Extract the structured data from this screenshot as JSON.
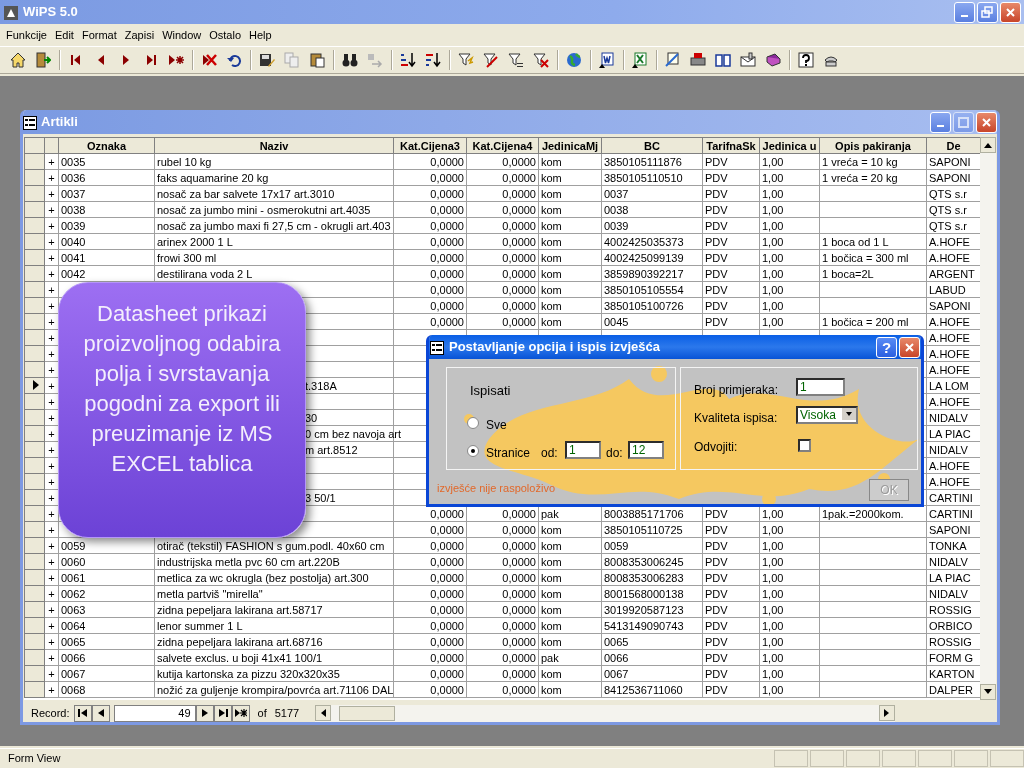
{
  "app": {
    "title": "WiPS 5.0"
  },
  "menu": [
    "Funkcije",
    "Edit",
    "Format",
    "Zapisi",
    "Window",
    "Ostalo",
    "Help"
  ],
  "window": {
    "title": "Artikli",
    "controls": [
      {
        "kind": "minimize",
        "disabled": false
      },
      {
        "kind": "maximize",
        "disabled": true
      },
      {
        "kind": "close",
        "disabled": false
      }
    ],
    "columns": [
      "Oznaka",
      "Naziv",
      "Kat.Cijena3",
      "Kat.Cijena4",
      "JedinicaMj",
      "BC",
      "TarifnaSk",
      "Jedinica u",
      "Opis pakiranja",
      "De"
    ],
    "rows": [
      {
        "current": false,
        "expander": "+",
        "oznaka": "0035",
        "naziv": "rubel 10 kg",
        "kat_cijena3": "0,0000",
        "kat_cijena4": "0,0000",
        "jedinica_mj": "kom",
        "bc": "3850105111876",
        "tarifna_sk": "PDV",
        "jedinica_u": "1,00",
        "opis_pakiranja": "1 vreća = 10 kg",
        "de": "SAPONI"
      },
      {
        "current": false,
        "expander": "+",
        "oznaka": "0036",
        "naziv": "faks aquamarine  20 kg",
        "kat_cijena3": "0,0000",
        "kat_cijena4": "0,0000",
        "jedinica_mj": "kom",
        "bc": "3850105110510",
        "tarifna_sk": "PDV",
        "jedinica_u": "1,00",
        "opis_pakiranja": "1 vreća = 20 kg",
        "de": "SAPONI"
      },
      {
        "current": false,
        "expander": "+",
        "oznaka": "0037",
        "naziv": "nosač za bar salvete 17x17 art.3010",
        "kat_cijena3": "0,0000",
        "kat_cijena4": "0,0000",
        "jedinica_mj": "kom",
        "bc": "0037",
        "tarifna_sk": "PDV",
        "jedinica_u": "1,00",
        "de": "QTS s.r"
      },
      {
        "current": false,
        "expander": "+",
        "oznaka": "0038",
        "naziv": "nosač za jumbo mini - osmerokutni art.4035",
        "kat_cijena3": "0,0000",
        "kat_cijena4": "0,0000",
        "jedinica_mj": "kom",
        "bc": "0038",
        "tarifna_sk": "PDV",
        "jedinica_u": "1,00",
        "de": "QTS s.r"
      },
      {
        "current": false,
        "expander": "+",
        "oznaka": "0039",
        "naziv": "nosač za jumbo maxi fi 27,5 cm - okrugli art.403",
        "kat_cijena3": "0,0000",
        "kat_cijena4": "0,0000",
        "jedinica_mj": "kom",
        "bc": "0039",
        "tarifna_sk": "PDV",
        "jedinica_u": "1,00",
        "de": "QTS s.r"
      },
      {
        "current": false,
        "expander": "+",
        "oznaka": "0040",
        "naziv": "arinex 2000 1 L",
        "kat_cijena3": "0,0000",
        "kat_cijena4": "0,0000",
        "jedinica_mj": "kom",
        "bc": "4002425035373",
        "tarifna_sk": "PDV",
        "jedinica_u": "1,00",
        "opis_pakiranja": "1 boca od 1 L",
        "de": "A.HOFE"
      },
      {
        "current": false,
        "expander": "+",
        "oznaka": "0041",
        "naziv": "frowi 300 ml",
        "kat_cijena3": "0,0000",
        "kat_cijena4": "0,0000",
        "jedinica_mj": "kom",
        "bc": "4002425099139",
        "tarifna_sk": "PDV",
        "jedinica_u": "1,00",
        "opis_pakiranja": "1 bočica = 300 ml",
        "de": "A.HOFE"
      },
      {
        "current": false,
        "expander": "+",
        "oznaka": "0042",
        "naziv": "destilirana voda 2 L",
        "kat_cijena3": "0,0000",
        "kat_cijena4": "0,0000",
        "jedinica_mj": "kom",
        "bc": "3859890392217",
        "tarifna_sk": "PDV",
        "jedinica_u": "1,00",
        "opis_pakiranja": "1 boca=2L",
        "de": "ARGENT"
      },
      {
        "current": false,
        "expander": "+",
        "kat_cijena3": "0,0000",
        "kat_cijena4": "0,0000",
        "jedinica_mj": "kom",
        "bc": "3850105105554",
        "tarifna_sk": "PDV",
        "jedinica_u": "1,00",
        "de": "LABUD"
      },
      {
        "current": false,
        "expander": "+",
        "kat_cijena3": "0,0000",
        "kat_cijena4": "0,0000",
        "jedinica_mj": "kom",
        "bc": "3850105100726",
        "tarifna_sk": "PDV",
        "jedinica_u": "1,00",
        "de": "SAPONI"
      },
      {
        "current": false,
        "expander": "+",
        "kat_cijena3": "0,0000",
        "kat_cijena4": "0,0000",
        "jedinica_mj": "kom",
        "bc": "0045",
        "tarifna_sk": "PDV",
        "jedinica_u": "1,00",
        "opis_pakiranja": "1 bočica = 200 ml",
        "de": "A.HOFE"
      },
      {
        "current": false,
        "expander": "+",
        "de": "A.HOFE"
      },
      {
        "current": false,
        "expander": "+",
        "de": "A.HOFE"
      },
      {
        "current": false,
        "expander": "+",
        "de": "A.HOFE"
      },
      {
        "current": true,
        "expander": "+",
        "naziv_tail": "t.318A",
        "de": "LA LOM"
      },
      {
        "current": false,
        "expander": "+",
        "de": "A.HOFE"
      },
      {
        "current": false,
        "expander": "+",
        "naziv_tail": "30",
        "de": "NIDALV"
      },
      {
        "current": false,
        "expander": "+",
        "naziv_tail": "0 cm bez navoja art",
        "de": "LA PIAC"
      },
      {
        "current": false,
        "expander": "+",
        "naziv_tail": "m art.8512",
        "de": "NIDALV"
      },
      {
        "current": false,
        "expander": "+",
        "de": "A.HOFE"
      },
      {
        "current": false,
        "expander": "+",
        "de": "A.HOFE"
      },
      {
        "current": false,
        "expander": "+",
        "naziv_tail": "3 50/1",
        "de": "CARTINI"
      },
      {
        "current": false,
        "expander": "+",
        "kat_cijena3": "0,0000",
        "kat_cijena4": "0,0000",
        "jedinica_mj": "pak",
        "bc": "8003885171706",
        "tarifna_sk": "PDV",
        "jedinica_u": "1,00",
        "opis_pakiranja": "1pak.=2000kom.",
        "de": "CARTINI"
      },
      {
        "current": false,
        "expander": "+",
        "kat_cijena3": "0,0000",
        "kat_cijena4": "0,0000",
        "jedinica_mj": "kom",
        "bc": "3850105110725",
        "tarifna_sk": "PDV",
        "jedinica_u": "1,00",
        "de": "SAPONI"
      },
      {
        "current": false,
        "expander": "+",
        "oznaka": "0059",
        "naziv": "otirač (tekstil) FASHION s gum.podl. 40x60 cm",
        "kat_cijena3": "0,0000",
        "kat_cijena4": "0,0000",
        "jedinica_mj": "kom",
        "bc": "0059",
        "tarifna_sk": "PDV",
        "jedinica_u": "1,00",
        "de": "TONKA"
      },
      {
        "current": false,
        "expander": "+",
        "oznaka": "0060",
        "naziv": "industrijska metla pvc 60 cm art.220B",
        "kat_cijena3": "0,0000",
        "kat_cijena4": "0,0000",
        "jedinica_mj": "kom",
        "bc": "8008353006245",
        "tarifna_sk": "PDV",
        "jedinica_u": "1,00",
        "de": "NIDALV"
      },
      {
        "current": false,
        "expander": "+",
        "oznaka": "0061",
        "naziv": "metlica za wc okrugla (bez postolja) art.300",
        "kat_cijena3": "0,0000",
        "kat_cijena4": "0,0000",
        "jedinica_mj": "kom",
        "bc": "8008353006283",
        "tarifna_sk": "PDV",
        "jedinica_u": "1,00",
        "de": "LA PIAC"
      },
      {
        "current": false,
        "expander": "+",
        "oznaka": "0062",
        "naziv": "metla partviš \"mirella\"",
        "kat_cijena3": "0,0000",
        "kat_cijena4": "0,0000",
        "jedinica_mj": "kom",
        "bc": "8001568000138",
        "tarifna_sk": "PDV",
        "jedinica_u": "1,00",
        "de": "NIDALV"
      },
      {
        "current": false,
        "expander": "+",
        "oznaka": "0063",
        "naziv": "zidna pepeljara lakirana art.58717",
        "kat_cijena3": "0,0000",
        "kat_cijena4": "0,0000",
        "jedinica_mj": "kom",
        "bc": "3019920587123",
        "tarifna_sk": "PDV",
        "jedinica_u": "1,00",
        "de": "ROSSIG"
      },
      {
        "current": false,
        "expander": "+",
        "oznaka": "0064",
        "naziv": "lenor summer 1 L",
        "kat_cijena3": "0,0000",
        "kat_cijena4": "0,0000",
        "jedinica_mj": "kom",
        "bc": "5413149090743",
        "tarifna_sk": "PDV",
        "jedinica_u": "1,00",
        "de": "ORBICO"
      },
      {
        "current": false,
        "expander": "+",
        "oznaka": "0065",
        "naziv": "zidna pepeljara lakirana art.68716",
        "kat_cijena3": "0,0000",
        "kat_cijena4": "0,0000",
        "jedinica_mj": "kom",
        "bc": "0065",
        "tarifna_sk": "PDV",
        "jedinica_u": "1,00",
        "de": "ROSSIG"
      },
      {
        "current": false,
        "expander": "+",
        "oznaka": "0066",
        "naziv": "salvete exclus. u boji 41x41 100/1",
        "kat_cijena3": "0,0000",
        "kat_cijena4": "0,0000",
        "jedinica_mj": "pak",
        "bc": "0066",
        "tarifna_sk": "PDV",
        "jedinica_u": "1,00",
        "de": "FORM G"
      },
      {
        "current": false,
        "expander": "+",
        "oznaka": "0067",
        "naziv": "kutija kartonska  za pizzu 320x320x35",
        "kat_cijena3": "0,0000",
        "kat_cijena4": "0,0000",
        "jedinica_mj": "kom",
        "bc": "0067",
        "tarifna_sk": "PDV",
        "jedinica_u": "1,00",
        "de": "KARTON"
      },
      {
        "current": false,
        "expander": "+",
        "oznaka": "0068",
        "naziv": "nožić za guljenje krompira/povrća art.71106 DAL",
        "kat_cijena3": "0,0000",
        "kat_cijena4": "0,0000",
        "jedinica_mj": "kom",
        "bc": "8412536711060",
        "tarifna_sk": "PDV",
        "jedinica_u": "1,00",
        "de": "DALPER"
      }
    ],
    "record_nav": {
      "label": "Record:",
      "current": "49",
      "of_label": "of",
      "total": "5177"
    }
  },
  "callout": {
    "text": "Datasheet prikazi proizvoljnog odabira polja i svrstavanja pogodni za export ili preuzimanje iz MS EXCEL tablica"
  },
  "dialog": {
    "title": "Postavljanje opcija i ispis izvješća",
    "help_label": "?",
    "group_label": "Ispisati",
    "options": [
      {
        "label": "Sve",
        "selected": false
      },
      {
        "label": "Stranice",
        "selected": true
      }
    ],
    "from_label": "od:",
    "from_value": "1",
    "to_label": "do:",
    "to_value": "12",
    "copies_label": "Broj primjeraka:",
    "copies_value": "1",
    "quality_label": "Kvaliteta ispisa:",
    "quality_value": "Visoka",
    "separate_label": "Odvojiti:",
    "separate_checked": false,
    "message": "izvješće nije raspoloživo",
    "ok": {
      "label": "OK",
      "disabled": true
    }
  },
  "status_bar": {
    "text": "Form View"
  }
}
